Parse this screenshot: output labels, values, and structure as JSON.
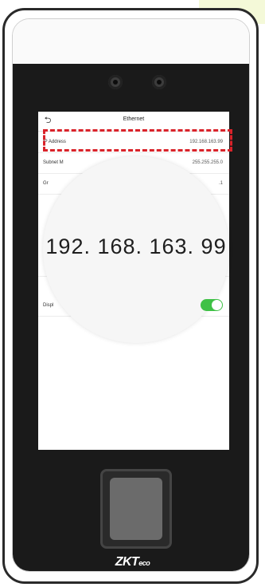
{
  "screen": {
    "title": "Ethernet",
    "rows": [
      {
        "label": "IP Address",
        "value": "192.168.163.99"
      },
      {
        "label": "Subnet M",
        "value": "255.255.255.0"
      },
      {
        "label": "Gr",
        "value": ".1"
      },
      {
        "label": "",
        "value": ""
      },
      {
        "label": "Displ",
        "value": ""
      }
    ]
  },
  "magnifier": {
    "text": "192. 168. 163. 99"
  },
  "logo": {
    "main": "ZKT",
    "sub": "eco"
  },
  "icons": {
    "back": "back-arrow-icon"
  },
  "colors": {
    "highlight": "#d9232a",
    "toggle_on": "#3fc146",
    "device_body": "#1a1a1a"
  },
  "display_toggle_on": true
}
